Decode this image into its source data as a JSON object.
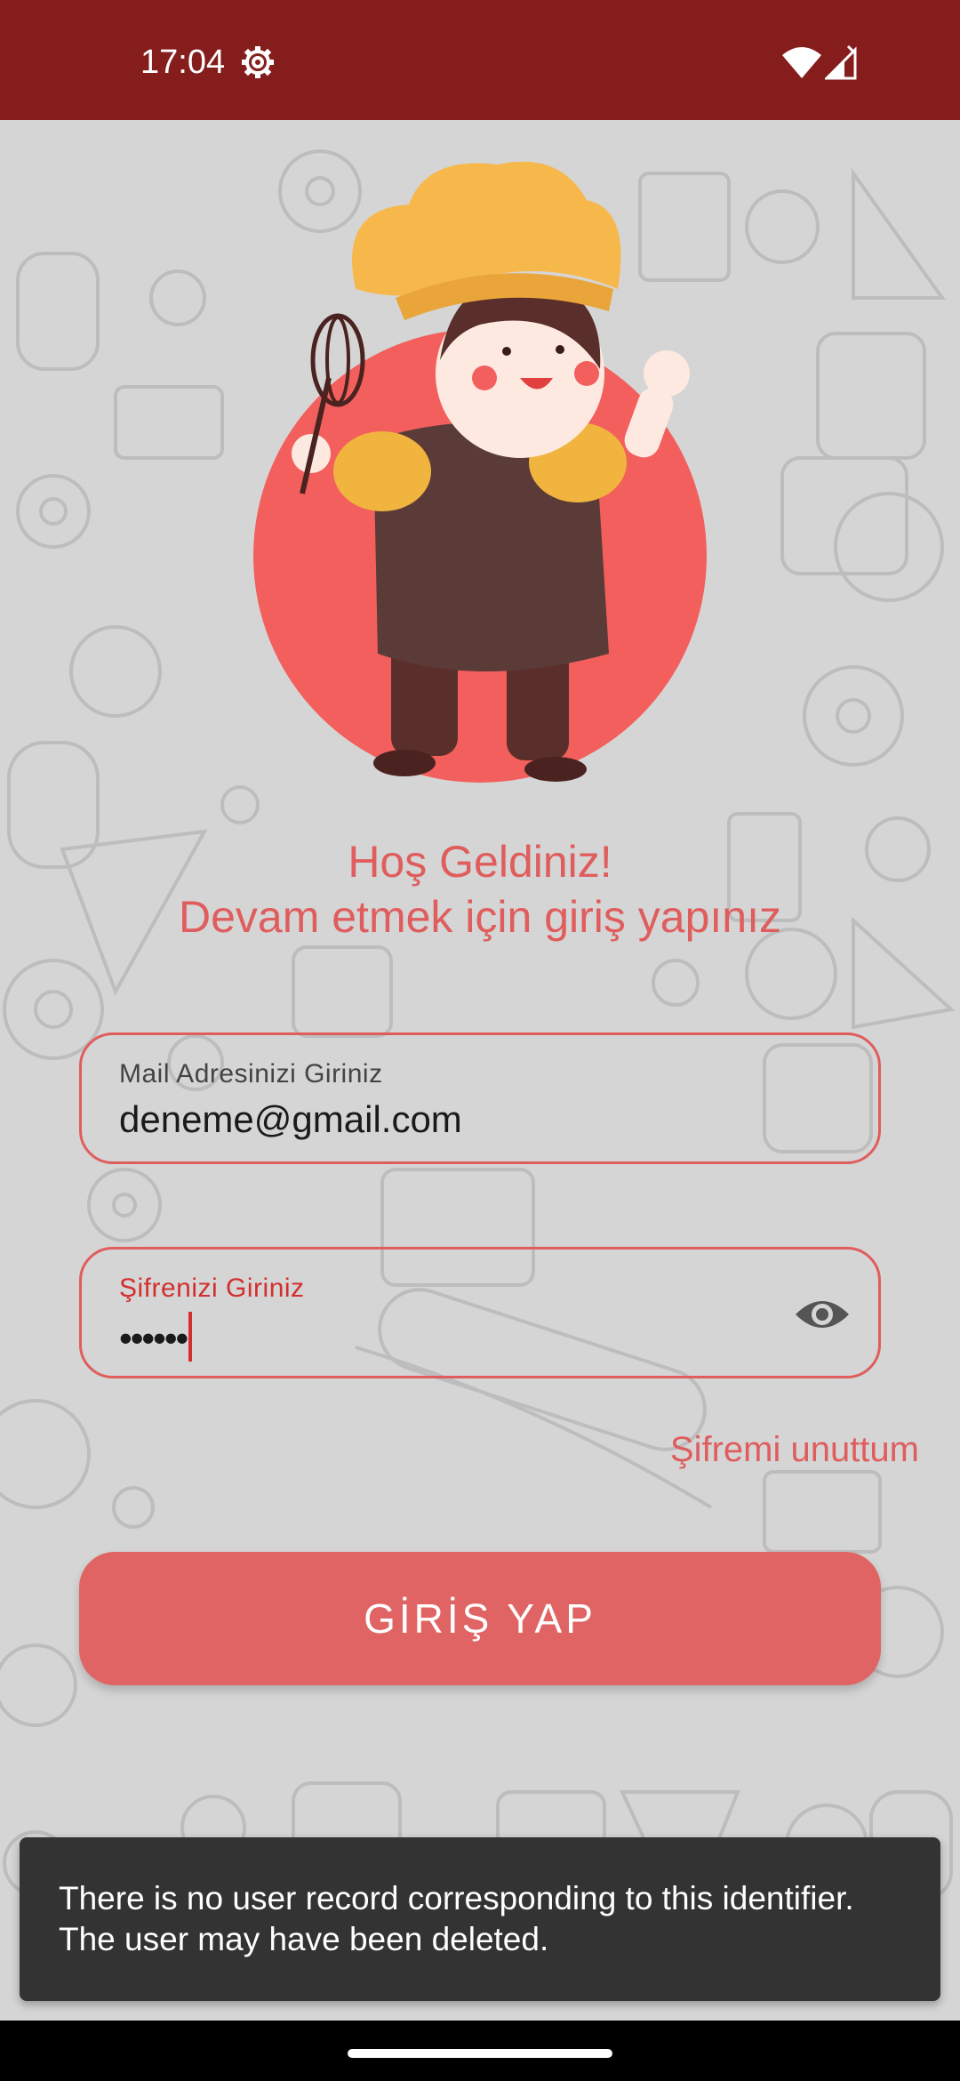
{
  "status_bar": {
    "time": "17:04",
    "icons": [
      "settings-gear-icon",
      "wifi-icon",
      "signal-icon"
    ]
  },
  "welcome": {
    "line1": "Hoş Geldiniz!",
    "line2": "Devam etmek için giriş yapınız"
  },
  "email_field": {
    "label": "Mail Adresinizi Giriniz",
    "value": "deneme@gmail.com"
  },
  "password_field": {
    "label": "Şifrenizi Giriniz",
    "value": "••••••",
    "toggle_icon": "eye-icon"
  },
  "forgot_password": "Şifremi unuttum",
  "login_button": "GİRİŞ YAP",
  "snackbar": {
    "message": "There is no user record corresponding to this identifier. The user may have been deleted."
  },
  "colors": {
    "status_bar": "#861d1d",
    "accent": "#e05d5d",
    "button": "#e06464",
    "background": "#d5d5d5",
    "snackbar": "#333333"
  }
}
